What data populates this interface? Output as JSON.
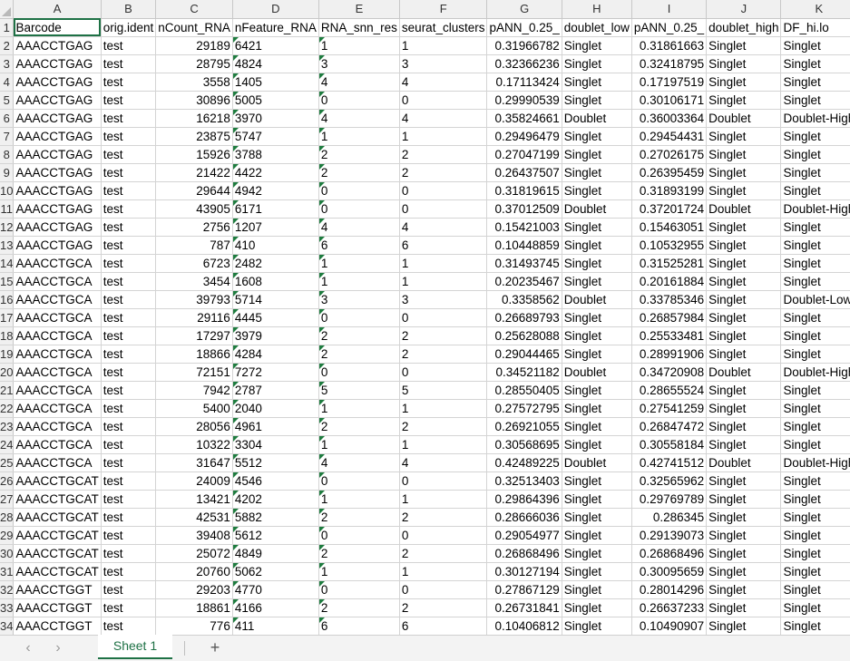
{
  "columns": [
    "A",
    "B",
    "C",
    "D",
    "E",
    "F",
    "G",
    "H",
    "I",
    "J",
    "K"
  ],
  "selected_cell": "A1",
  "headers": [
    "Barcode",
    "orig.ident",
    "nCount_RNA",
    "nFeature_RNA",
    "RNA_snn_res",
    "seurat_clusters",
    "pANN_0.25_",
    "doublet_low",
    "pANN_0.25_",
    "doublet_high",
    "DF_hi.lo"
  ],
  "rows": [
    [
      "AAACCTGAG",
      "test",
      "29189",
      "6421",
      "1",
      "1",
      "0.31966782",
      "Singlet",
      "0.31861663",
      "Singlet",
      "Singlet"
    ],
    [
      "AAACCTGAG",
      "test",
      "28795",
      "4824",
      "3",
      "3",
      "0.32366236",
      "Singlet",
      "0.32418795",
      "Singlet",
      "Singlet"
    ],
    [
      "AAACCTGAG",
      "test",
      "3558",
      "1405",
      "4",
      "4",
      "0.17113424",
      "Singlet",
      "0.17197519",
      "Singlet",
      "Singlet"
    ],
    [
      "AAACCTGAG",
      "test",
      "30896",
      "5005",
      "0",
      "0",
      "0.29990539",
      "Singlet",
      "0.30106171",
      "Singlet",
      "Singlet"
    ],
    [
      "AAACCTGAG",
      "test",
      "16218",
      "3970",
      "4",
      "4",
      "0.35824661",
      "Doublet",
      "0.36003364",
      "Doublet",
      "Doublet-High"
    ],
    [
      "AAACCTGAG",
      "test",
      "23875",
      "5747",
      "1",
      "1",
      "0.29496479",
      "Singlet",
      "0.29454431",
      "Singlet",
      "Singlet"
    ],
    [
      "AAACCTGAG",
      "test",
      "15926",
      "3788",
      "2",
      "2",
      "0.27047199",
      "Singlet",
      "0.27026175",
      "Singlet",
      "Singlet"
    ],
    [
      "AAACCTGAG",
      "test",
      "21422",
      "4422",
      "2",
      "2",
      "0.26437507",
      "Singlet",
      "0.26395459",
      "Singlet",
      "Singlet"
    ],
    [
      "AAACCTGAG",
      "test",
      "29644",
      "4942",
      "0",
      "0",
      "0.31819615",
      "Singlet",
      "0.31893199",
      "Singlet",
      "Singlet"
    ],
    [
      "AAACCTGAG",
      "test",
      "43905",
      "6171",
      "0",
      "0",
      "0.37012509",
      "Doublet",
      "0.37201724",
      "Doublet",
      "Doublet-High"
    ],
    [
      "AAACCTGAG",
      "test",
      "2756",
      "1207",
      "4",
      "4",
      "0.15421003",
      "Singlet",
      "0.15463051",
      "Singlet",
      "Singlet"
    ],
    [
      "AAACCTGAG",
      "test",
      "787",
      "410",
      "6",
      "6",
      "0.10448859",
      "Singlet",
      "0.10532955",
      "Singlet",
      "Singlet"
    ],
    [
      "AAACCTGCA",
      "test",
      "6723",
      "2482",
      "1",
      "1",
      "0.31493745",
      "Singlet",
      "0.31525281",
      "Singlet",
      "Singlet"
    ],
    [
      "AAACCTGCA",
      "test",
      "3454",
      "1608",
      "1",
      "1",
      "0.20235467",
      "Singlet",
      "0.20161884",
      "Singlet",
      "Singlet"
    ],
    [
      "AAACCTGCA",
      "test",
      "39793",
      "5714",
      "3",
      "3",
      "0.3358562",
      "Doublet",
      "0.33785346",
      "Singlet",
      "Doublet-Low"
    ],
    [
      "AAACCTGCA",
      "test",
      "29116",
      "4445",
      "0",
      "0",
      "0.26689793",
      "Singlet",
      "0.26857984",
      "Singlet",
      "Singlet"
    ],
    [
      "AAACCTGCA",
      "test",
      "17297",
      "3979",
      "2",
      "2",
      "0.25628088",
      "Singlet",
      "0.25533481",
      "Singlet",
      "Singlet"
    ],
    [
      "AAACCTGCA",
      "test",
      "18866",
      "4284",
      "2",
      "2",
      "0.29044465",
      "Singlet",
      "0.28991906",
      "Singlet",
      "Singlet"
    ],
    [
      "AAACCTGCA",
      "test",
      "72151",
      "7272",
      "0",
      "0",
      "0.34521182",
      "Doublet",
      "0.34720908",
      "Doublet",
      "Doublet-High"
    ],
    [
      "AAACCTGCA",
      "test",
      "7942",
      "2787",
      "5",
      "5",
      "0.28550405",
      "Singlet",
      "0.28655524",
      "Singlet",
      "Singlet"
    ],
    [
      "AAACCTGCA",
      "test",
      "5400",
      "2040",
      "1",
      "1",
      "0.27572795",
      "Singlet",
      "0.27541259",
      "Singlet",
      "Singlet"
    ],
    [
      "AAACCTGCA",
      "test",
      "28056",
      "4961",
      "2",
      "2",
      "0.26921055",
      "Singlet",
      "0.26847472",
      "Singlet",
      "Singlet"
    ],
    [
      "AAACCTGCA",
      "test",
      "10322",
      "3304",
      "1",
      "1",
      "0.30568695",
      "Singlet",
      "0.30558184",
      "Singlet",
      "Singlet"
    ],
    [
      "AAACCTGCA",
      "test",
      "31647",
      "5512",
      "4",
      "4",
      "0.42489225",
      "Doublet",
      "0.42741512",
      "Doublet",
      "Doublet-High"
    ],
    [
      "AAACCTGCAT",
      "test",
      "24009",
      "4546",
      "0",
      "0",
      "0.32513403",
      "Singlet",
      "0.32565962",
      "Singlet",
      "Singlet"
    ],
    [
      "AAACCTGCAT",
      "test",
      "13421",
      "4202",
      "1",
      "1",
      "0.29864396",
      "Singlet",
      "0.29769789",
      "Singlet",
      "Singlet"
    ],
    [
      "AAACCTGCAT",
      "test",
      "42531",
      "5882",
      "2",
      "2",
      "0.28666036",
      "Singlet",
      "0.286345",
      "Singlet",
      "Singlet"
    ],
    [
      "AAACCTGCAT",
      "test",
      "39408",
      "5612",
      "0",
      "0",
      "0.29054977",
      "Singlet",
      "0.29139073",
      "Singlet",
      "Singlet"
    ],
    [
      "AAACCTGCAT",
      "test",
      "25072",
      "4849",
      "2",
      "2",
      "0.26868496",
      "Singlet",
      "0.26868496",
      "Singlet",
      "Singlet"
    ],
    [
      "AAACCTGCAT",
      "test",
      "20760",
      "5062",
      "1",
      "1",
      "0.30127194",
      "Singlet",
      "0.30095659",
      "Singlet",
      "Singlet"
    ],
    [
      "AAACCTGGT",
      "test",
      "29203",
      "4770",
      "0",
      "0",
      "0.27867129",
      "Singlet",
      "0.28014296",
      "Singlet",
      "Singlet"
    ],
    [
      "AAACCTGGT",
      "test",
      "18861",
      "4166",
      "2",
      "2",
      "0.26731841",
      "Singlet",
      "0.26637233",
      "Singlet",
      "Singlet"
    ],
    [
      "AAACCTGGT",
      "test",
      "776",
      "411",
      "6",
      "6",
      "0.10406812",
      "Singlet",
      "0.10490907",
      "Singlet",
      "Singlet"
    ]
  ],
  "sheet_tabs": [
    "Sheet 1"
  ],
  "tabbar": {
    "prev_arrow": "‹",
    "next_arrow": "›",
    "add_sheet": "+"
  },
  "colors": {
    "accent": "#1e7145",
    "header_bg": "#f0f0f0",
    "gridline": "#d4d4d4",
    "text_marker": "#1e7c3f"
  }
}
